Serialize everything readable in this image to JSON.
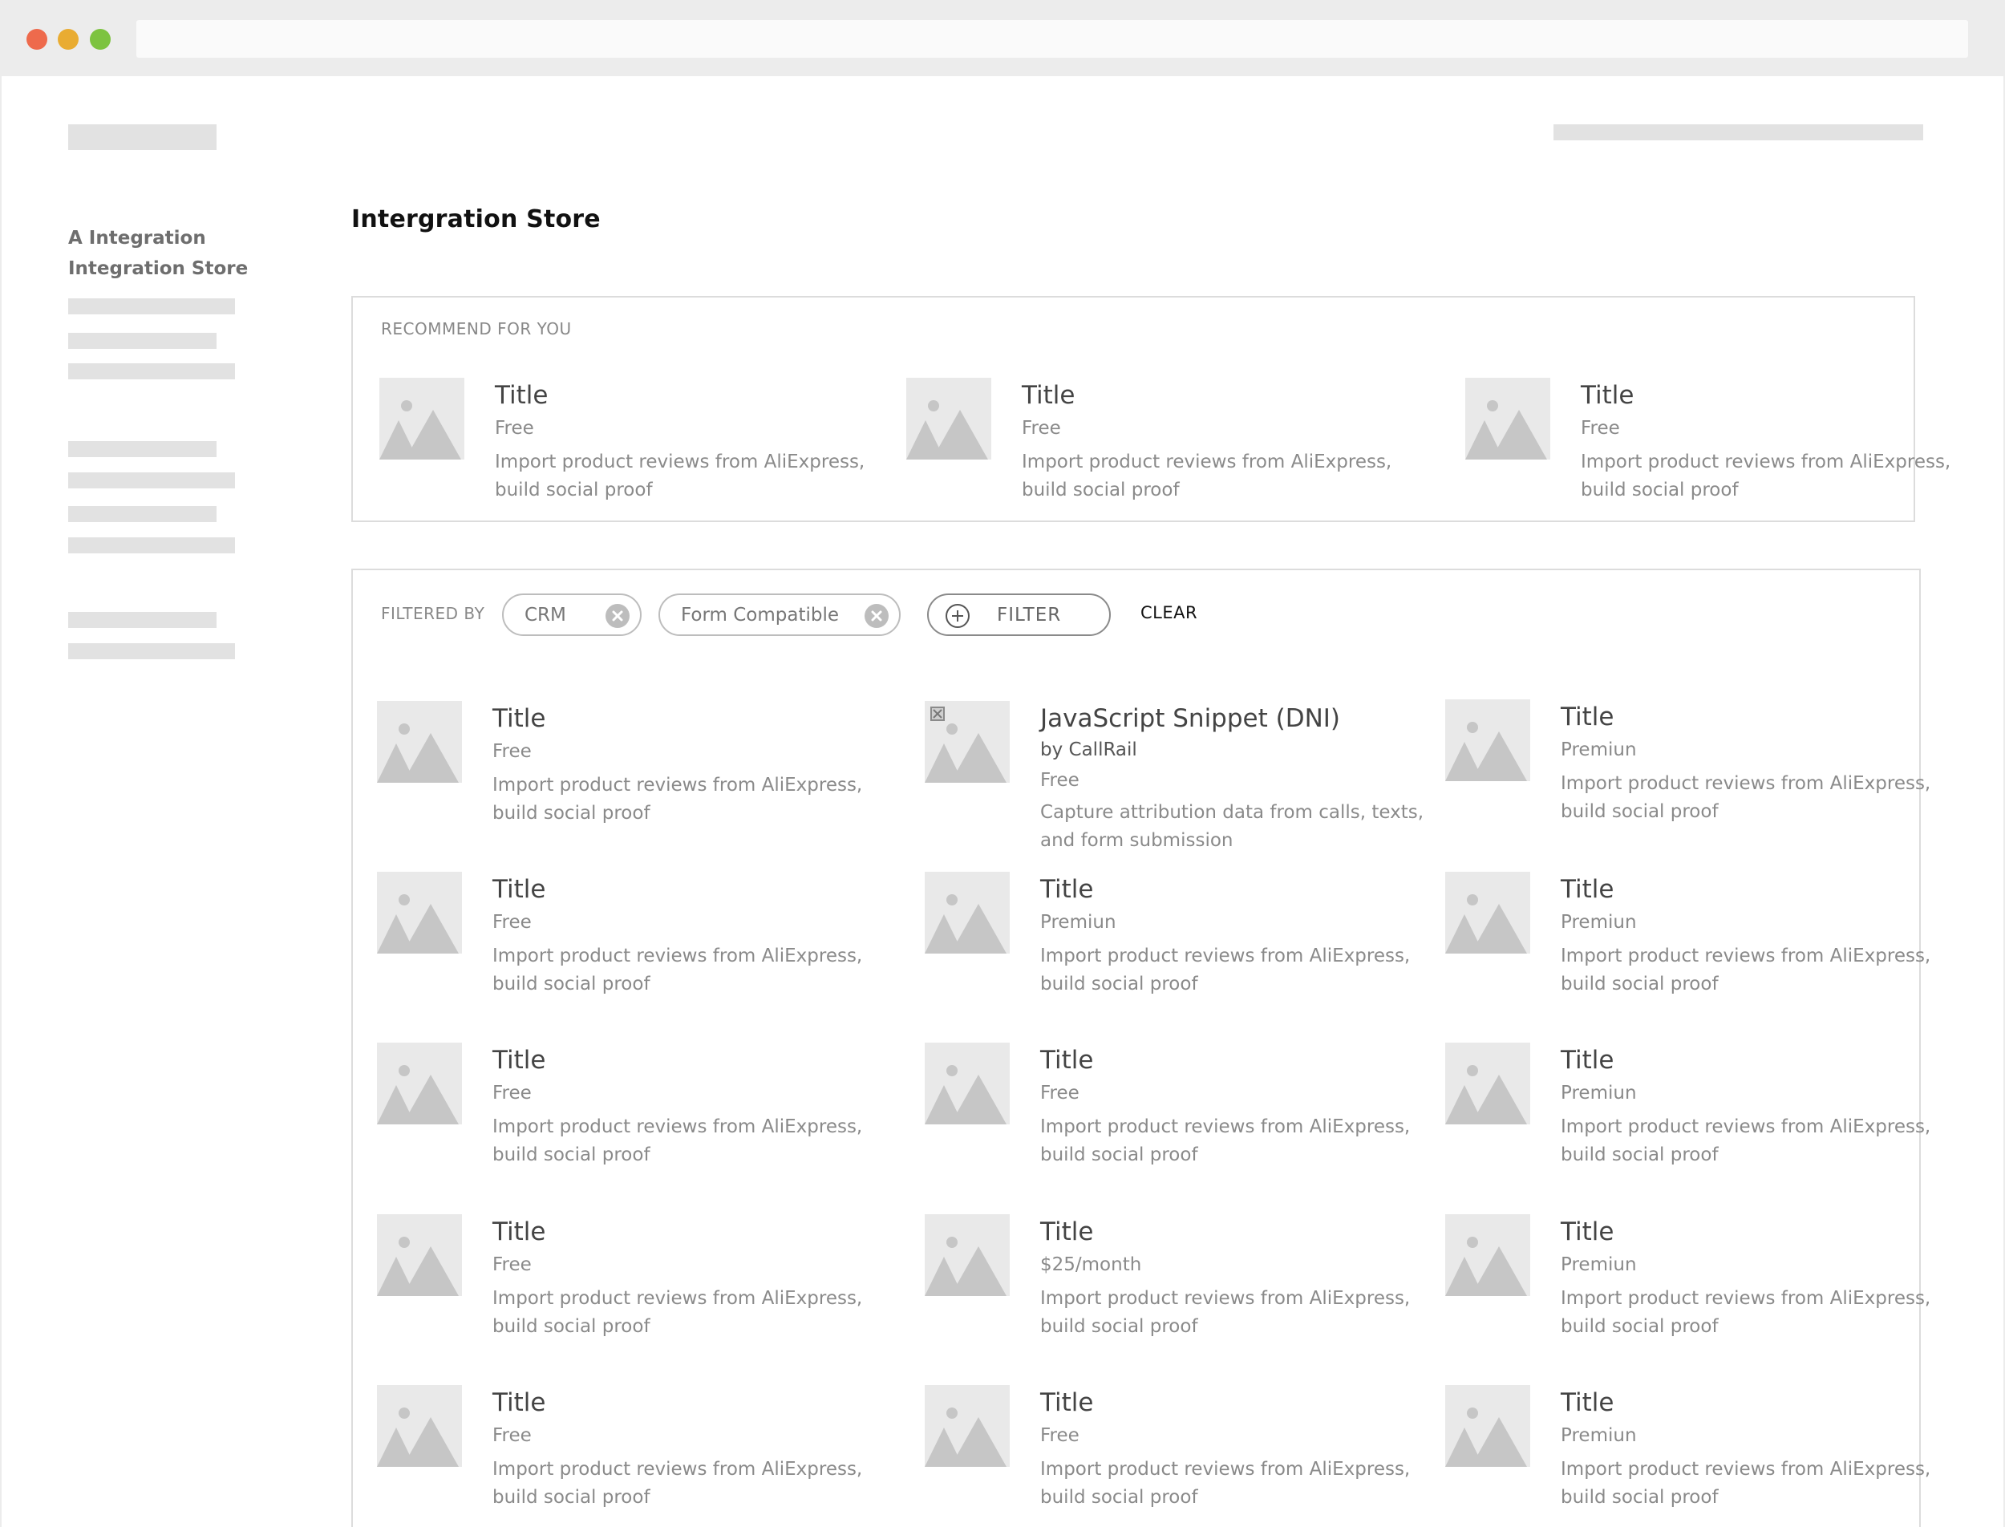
{
  "page": {
    "title": "Intergration Store"
  },
  "sidebar": {
    "items": [
      "A Integration",
      "Integration Store"
    ]
  },
  "recommend": {
    "label": "RECOMMEND FOR YOU",
    "cards": [
      {
        "title": "Title",
        "price": "Free",
        "desc": "Import product reviews from AliExpress, build social proof"
      },
      {
        "title": "Title",
        "price": "Free",
        "desc": "Import product reviews from AliExpress, build social proof"
      },
      {
        "title": "Title",
        "price": "Free",
        "desc": "Import product reviews from AliExpress, build social proof"
      }
    ]
  },
  "filters": {
    "label": "FILTERED BY",
    "chips": [
      "CRM",
      "Form Compatible"
    ],
    "filter_button": "FILTER",
    "clear": "CLEAR"
  },
  "results": [
    {
      "title": "Title",
      "price": "Free",
      "desc": "Import product reviews from AliExpress, build social proof"
    },
    {
      "title": "JavaScript Snippet (DNI)",
      "by": "by CallRail",
      "price": "Free",
      "desc": "Capture attribution data from calls, texts, and form submission"
    },
    {
      "title": "Title",
      "price": "Premiun",
      "desc": "Import product reviews from AliExpress, build social proof"
    },
    {
      "title": "Title",
      "price": "Free",
      "desc": "Import product reviews from AliExpress, build social proof"
    },
    {
      "title": "Title",
      "price": "Premiun",
      "desc": "Import product reviews from AliExpress, build social proof"
    },
    {
      "title": "Title",
      "price": "Premiun",
      "desc": "Import product reviews from AliExpress, build social proof"
    },
    {
      "title": "Title",
      "price": "Free",
      "desc": "Import product reviews from AliExpress, build social proof"
    },
    {
      "title": "Title",
      "price": "Free",
      "desc": "Import product reviews from AliExpress, build social proof"
    },
    {
      "title": "Title",
      "price": "Premiun",
      "desc": "Import product reviews from AliExpress, build social proof"
    },
    {
      "title": "Title",
      "price": "Free",
      "desc": "Import product reviews from AliExpress, build social proof"
    },
    {
      "title": "Title",
      "price": "$25/month",
      "desc": "Import product reviews from AliExpress, build social proof"
    },
    {
      "title": "Title",
      "price": "Premiun",
      "desc": "Import product reviews from AliExpress, build social proof"
    },
    {
      "title": "Title",
      "price": "Free",
      "desc": "Import product reviews from AliExpress, build social proof"
    },
    {
      "title": "Title",
      "price": "Free",
      "desc": "Import product reviews from AliExpress, build social proof"
    },
    {
      "title": "Title",
      "price": "Premiun",
      "desc": "Import product reviews from AliExpress, build social proof"
    }
  ],
  "icons": {
    "thumbnail": "image-placeholder-icon",
    "chip_remove": "close-circle-icon",
    "filter_add": "plus-circle-icon",
    "broken_image": "broken-image-icon"
  },
  "colors": {
    "window_red": "#ee6a4c",
    "window_yellow": "#e9ac32",
    "window_green": "#7dc340",
    "placeholder": "#e2e2e2",
    "border": "#dcdcdc"
  }
}
